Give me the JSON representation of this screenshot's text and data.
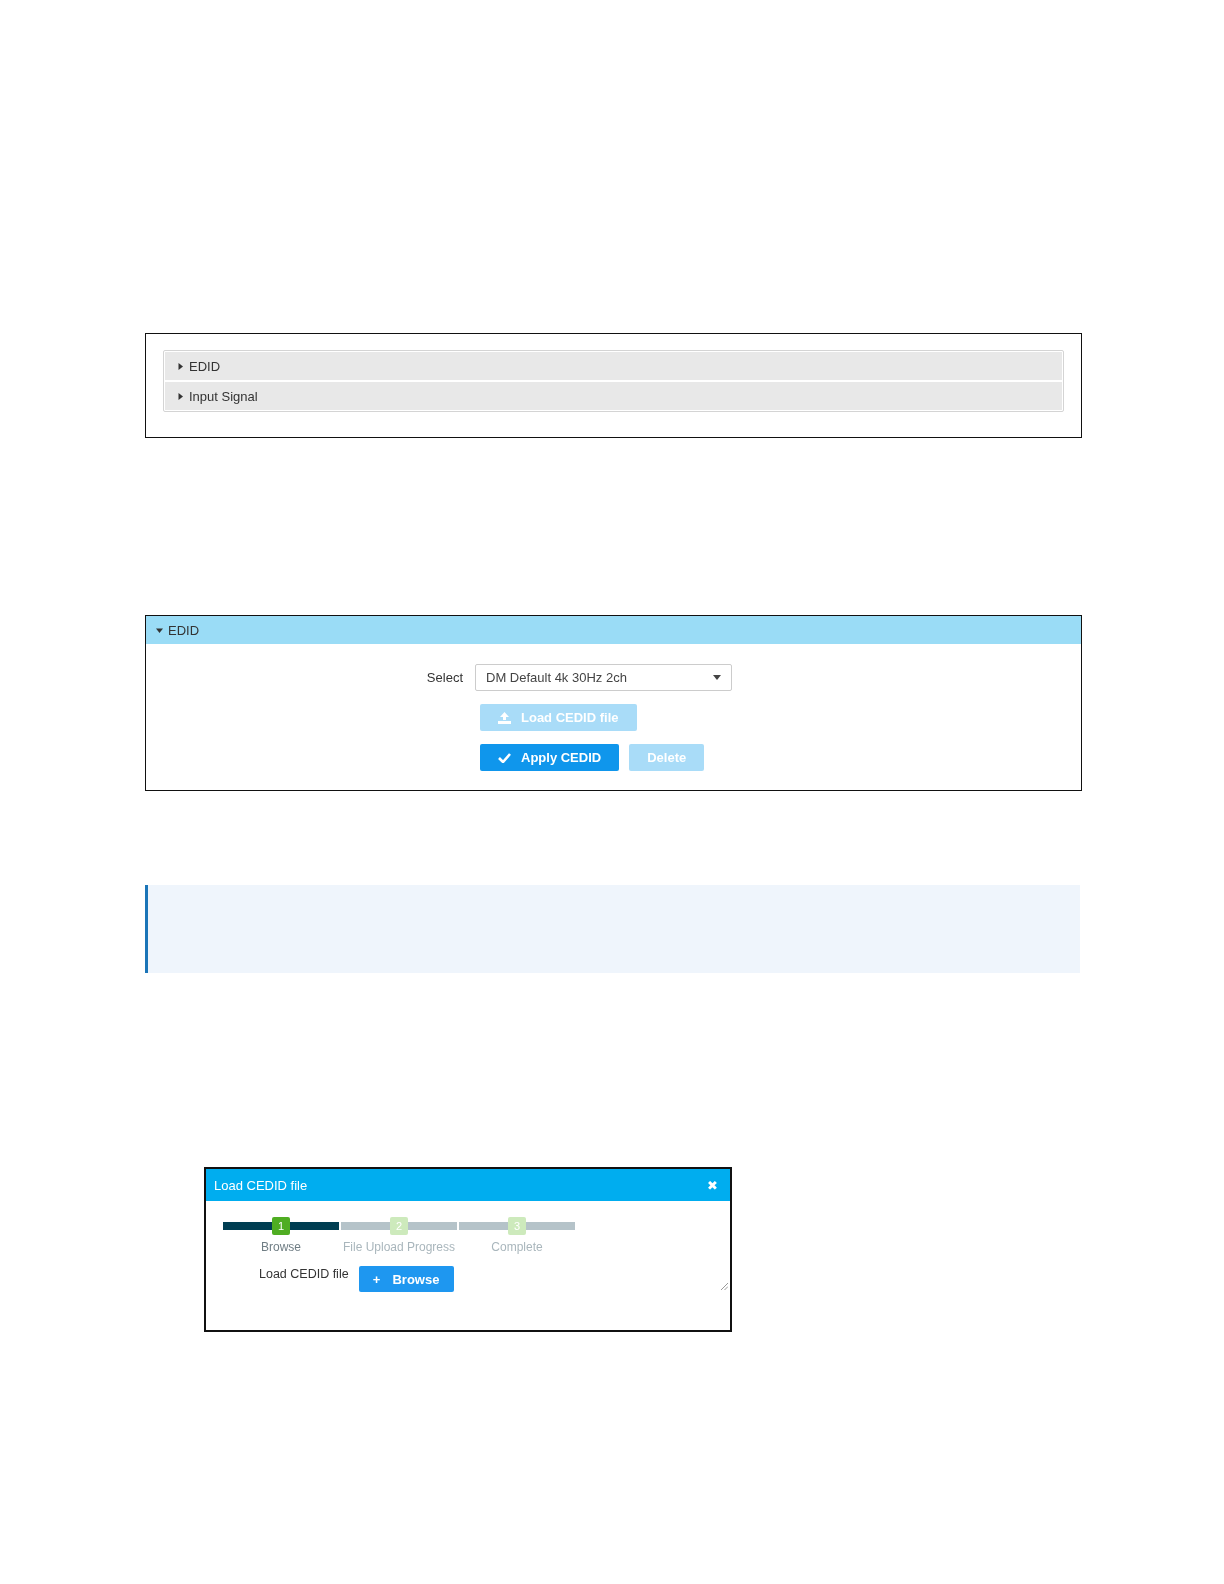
{
  "accordion": {
    "sections": [
      {
        "label": "EDID",
        "expanded": false
      },
      {
        "label": "Input Signal",
        "expanded": false
      }
    ]
  },
  "edid_panel": {
    "title": "EDID",
    "expanded": true,
    "select": {
      "label": "Select",
      "value": "DM Default 4k 30Hz 2ch"
    },
    "buttons": [
      {
        "label": "Load CEDID file",
        "kind": "upload",
        "disabled": true
      },
      {
        "label": "Apply CEDID",
        "kind": "check",
        "disabled": false
      },
      {
        "label": "Delete",
        "kind": "plain",
        "disabled": true
      }
    ]
  },
  "dialog": {
    "title": "Load CEDID file",
    "close": "✖",
    "steps": [
      {
        "number": "1",
        "label": "Browse",
        "selected": true
      },
      {
        "number": "2",
        "label": "File Upload Progress",
        "selected": false
      },
      {
        "number": "3",
        "label": "Complete",
        "selected": false
      }
    ],
    "field_label": "Load CEDID file",
    "browse_button": {
      "icon": "+",
      "label": "Browse"
    }
  }
}
